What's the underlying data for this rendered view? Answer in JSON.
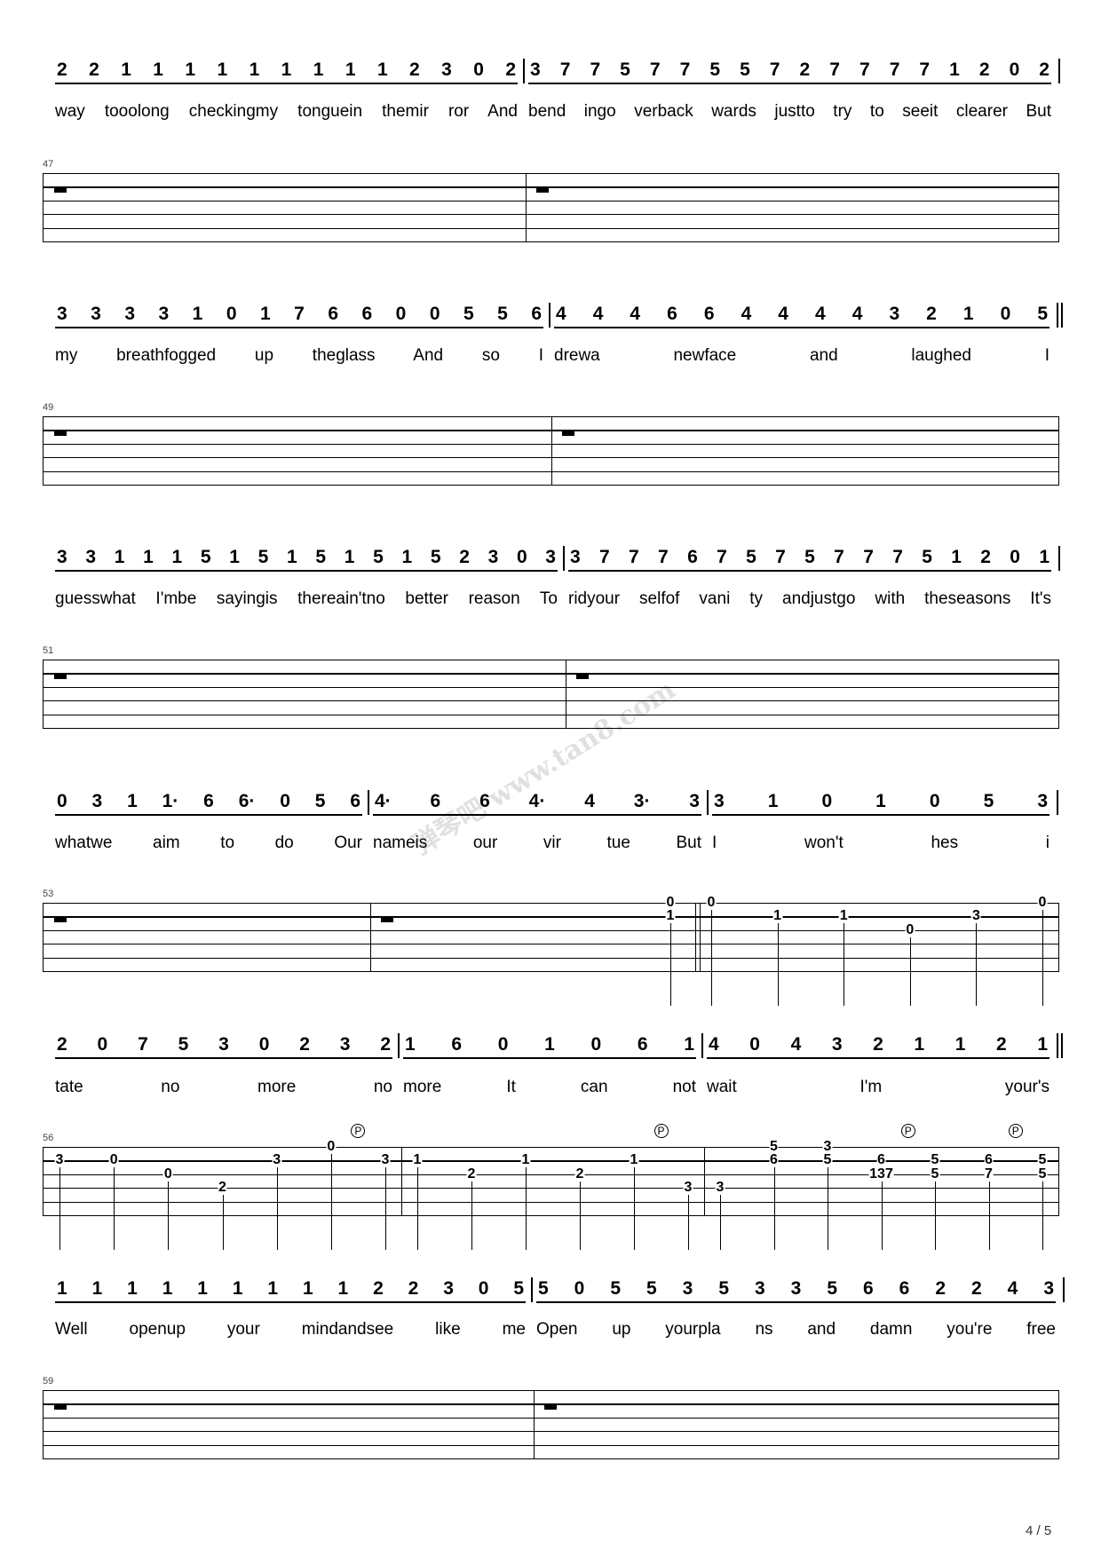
{
  "rows": [
    {
      "measures": [
        {
          "notes": "2 2 1 1 1 1 1 1 1 1 1 2 3 0 2",
          "lyrics": "way tooolong checkingmy tonguein themir ror And"
        },
        {
          "notes": "3 7 7 5 7 7 5 5 7 2 7 7 7 7 1 2 0 2",
          "lyrics": "bend ingo verback wards justto try to seeit clearer But"
        }
      ],
      "staff": {
        "number": "47",
        "measures": [
          {
            "rest": true
          },
          {
            "rest": true
          }
        ]
      }
    },
    {
      "measures": [
        {
          "notes": "3 3 3 3 1 0 1 7 6 6 0 0 5 5 6",
          "lyrics": "my breathfogged up theglass And so I"
        },
        {
          "notes": "4 4 4 6 6 4 4 4 4 3 2 1 0 5",
          "lyrics": "drewa newface and laughed I"
        }
      ],
      "staff": {
        "number": "49",
        "measures": [
          {
            "rest": true
          },
          {
            "rest": true
          }
        ]
      }
    },
    {
      "measures": [
        {
          "notes": "3 3 1 1 1 5 1 5 1 5 1 5 1 5 2 3 0 3",
          "lyrics": "guesswhat I'mbe sayingis thereain'tno better reason To"
        },
        {
          "notes": "3 7 7 7 6 7 5 7 5 7 7 7 5 1 2 0 1",
          "lyrics": "ridyour selfof vani ty andjustgo with theseasons It's"
        }
      ],
      "staff": {
        "number": "51",
        "measures": [
          {
            "rest": true
          },
          {
            "rest": true
          }
        ]
      }
    },
    {
      "measures": [
        {
          "notes": "0 3 1 1· 6 6· 0 5 6",
          "lyrics": "whatwe aim to do Our"
        },
        {
          "notes": "4· 6 6 4· 4 3· 3",
          "lyrics": "nameis our vir tue But"
        },
        {
          "notes": "3 1 0 1 0 5 3",
          "lyrics": "I won't hes i"
        }
      ],
      "staff": {
        "number": "53",
        "measures": [
          {
            "rest": true
          },
          {
            "rest": true,
            "events": [
              [
                [
                  1,
                  "0"
                ],
                [
                  2,
                  "1"
                ]
              ]
            ]
          },
          {
            "events": [
              [
                [
                  1,
                  "0"
                ]
              ],
              [
                [
                  2,
                  "1"
                ]
              ],
              [
                [
                  2,
                  "1"
                ]
              ],
              [
                [
                  3,
                  "0"
                ]
              ],
              [
                [
                  2,
                  "3"
                ]
              ],
              [
                [
                  1,
                  "0"
                ]
              ]
            ]
          }
        ]
      }
    },
    {
      "measures": [
        {
          "notes": "2 0 7 5 3 0 2 3 2",
          "lyrics": "tate no more no"
        },
        {
          "notes": "1 6 0 1 0 6 1",
          "lyrics": "more It can not"
        },
        {
          "notes": "4 0 4 3 2 1 1 2 1",
          "lyrics": "wait I'm your's"
        }
      ],
      "staff": {
        "number": "56",
        "measures": [
          {
            "events": [
              [
                [
                  2,
                  "3"
                ]
              ],
              [
                [
                  2,
                  "0"
                ]
              ],
              [
                [
                  3,
                  "0"
                ]
              ],
              [
                [
                  4,
                  "2"
                ]
              ],
              [
                [
                  2,
                  "3"
                ]
              ],
              [
                [
                  1,
                  "0"
                ]
              ],
              [
                [
                  2,
                  "3"
                ]
              ]
            ],
            "pull_offs": [
              5
            ],
            "pull_label": "P"
          },
          {
            "events": [
              [
                [
                  2,
                  "1"
                ]
              ],
              [
                [
                  3,
                  "2"
                ]
              ],
              [
                [
                  2,
                  "1"
                ]
              ],
              [
                [
                  3,
                  "2"
                ]
              ],
              [
                [
                  2,
                  "1"
                ]
              ],
              [
                [
                  4,
                  "3"
                ]
              ]
            ],
            "pull_offs": [
              4
            ],
            "pull_label": "P"
          },
          {
            "events": [
              [
                [
                  4,
                  "3"
                ]
              ],
              [
                [
                  1,
                  "5"
                ],
                [
                  2,
                  "6"
                ]
              ],
              [
                [
                  1,
                  "3"
                ],
                [
                  2,
                  "5"
                ]
              ],
              [
                [
                  2,
                  "6"
                ],
                [
                  3,
                  "137"
                ]
              ],
              [
                [
                  2,
                  "5"
                ],
                [
                  3,
                  "5"
                ]
              ],
              [
                [
                  2,
                  "6"
                ],
                [
                  3,
                  "7"
                ]
              ],
              [
                [
                  2,
                  "5"
                ],
                [
                  3,
                  "5"
                ]
              ]
            ],
            "pull_offs": [
              3,
              5
            ],
            "pull_label": "P"
          }
        ]
      }
    },
    {
      "measures": [
        {
          "notes": "1 1 1 1 1 1 1 1 1 2 2 3 0 5",
          "lyrics": "Well openup your mindandsee like me"
        },
        {
          "notes": "5 0 5 5 3 5 3 3 5 6 6 2 2 4 3",
          "lyrics": "Open up yourpla ns and damn you're free"
        }
      ],
      "staff": {
        "number": "59",
        "measures": [
          {
            "rest": true
          },
          {
            "rest": true
          }
        ]
      }
    }
  ],
  "watermark": "弹琴吧 www.tan8.com",
  "page_number": "4 / 5"
}
